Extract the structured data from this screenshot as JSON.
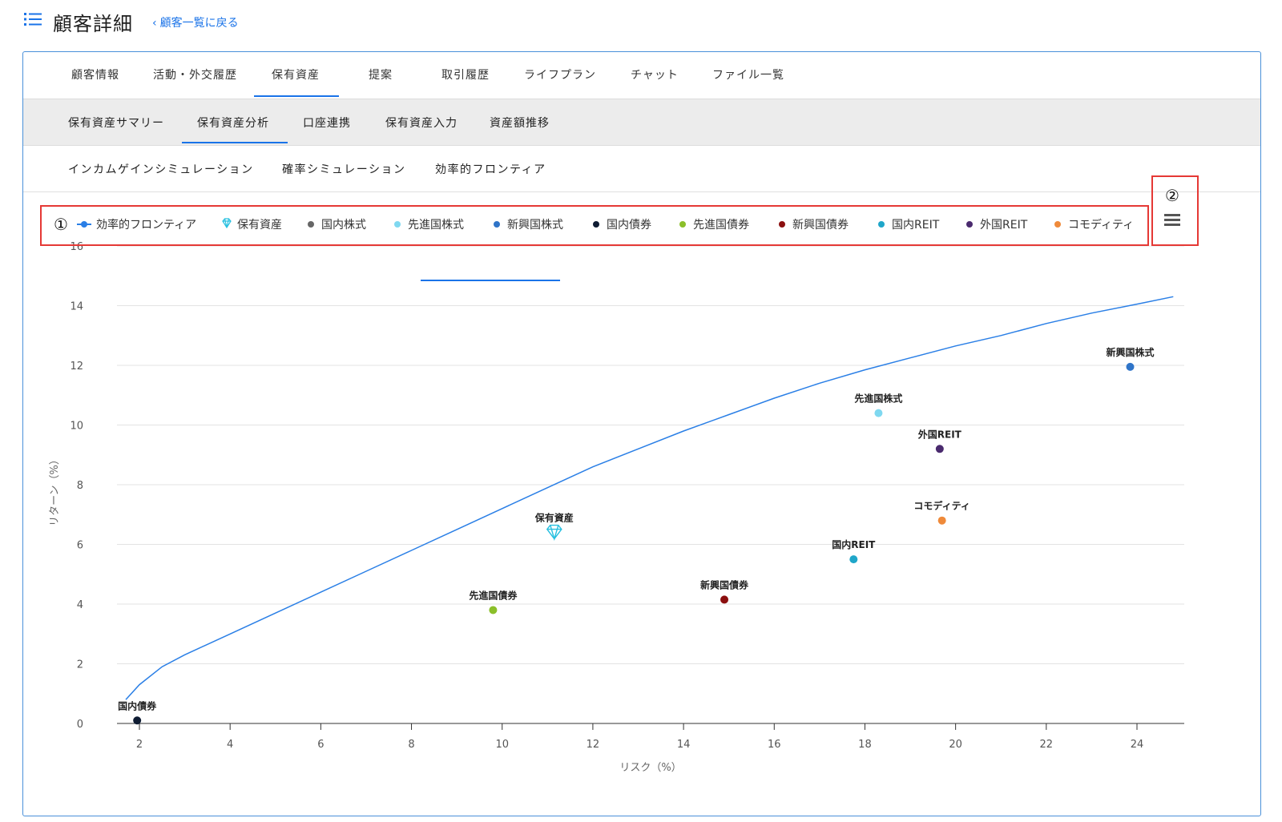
{
  "header": {
    "title": "顧客詳細",
    "back_label": "顧客一覧に戻る"
  },
  "tabs": [
    {
      "label": "顧客情報",
      "active": false
    },
    {
      "label": "活動・外交履歴",
      "active": false
    },
    {
      "label": "保有資産",
      "active": true
    },
    {
      "label": "提案",
      "active": false
    },
    {
      "label": "取引履歴",
      "active": false
    },
    {
      "label": "ライフプラン",
      "active": false
    },
    {
      "label": "チャット",
      "active": false
    },
    {
      "label": "ファイル一覧",
      "active": false
    }
  ],
  "subtabs": [
    {
      "label": "保有資産サマリー",
      "active": false
    },
    {
      "label": "保有資産分析",
      "active": true
    },
    {
      "label": "口座連携",
      "active": false
    },
    {
      "label": "保有資産入力",
      "active": false
    },
    {
      "label": "資産額推移",
      "active": false
    }
  ],
  "subsubtabs": [
    {
      "label": "インカムゲインシミュレーション",
      "active": false
    },
    {
      "label": "確率シミュレーション",
      "active": false
    },
    {
      "label": "効率的フロンティア",
      "active": true
    }
  ],
  "annotations": {
    "one": "①",
    "two": "②"
  },
  "colors": {
    "accent": "#1a73e8",
    "annotation": "#e53935",
    "frontier_line": "#2a7fe6"
  },
  "chart_data": {
    "type": "scatter",
    "xlabel": "リスク（%）",
    "ylabel": "リターン（%）",
    "xlim": [
      1.5,
      25
    ],
    "ylim": [
      0,
      16
    ],
    "x_ticks": [
      2,
      4,
      6,
      8,
      10,
      12,
      14,
      16,
      18,
      20,
      22,
      24
    ],
    "y_ticks": [
      0,
      2,
      4,
      6,
      8,
      10,
      12,
      14,
      16
    ],
    "grid": "horizontal",
    "legend": [
      {
        "name": "効率的フロンティア",
        "color": "#2a7fe6",
        "marker": "line-dot"
      },
      {
        "name": "保有資産",
        "color": "#28c0e0",
        "marker": "diamond"
      },
      {
        "name": "国内株式",
        "color": "#666666",
        "marker": "dot"
      },
      {
        "name": "先進国株式",
        "color": "#7fd8f0",
        "marker": "dot"
      },
      {
        "name": "新興国株式",
        "color": "#2f74c8",
        "marker": "dot"
      },
      {
        "name": "国内債券",
        "color": "#0f1c33",
        "marker": "dot"
      },
      {
        "name": "先進国債券",
        "color": "#8bbf2a",
        "marker": "dot"
      },
      {
        "name": "新興国債券",
        "color": "#8b0f0f",
        "marker": "dot"
      },
      {
        "name": "国内REIT",
        "color": "#1fa6c9",
        "marker": "dot"
      },
      {
        "name": "外国REIT",
        "color": "#4a2a6e",
        "marker": "dot"
      },
      {
        "name": "コモディティ",
        "color": "#ef8a3a",
        "marker": "dot"
      }
    ],
    "legend_placement": "top",
    "series": [
      {
        "name": "効率的フロンティア",
        "type": "line",
        "color": "#2a7fe6",
        "x": [
          1.7,
          2.0,
          2.5,
          3.0,
          4.0,
          5.0,
          6.0,
          7.0,
          8.0,
          9.0,
          10.0,
          11.0,
          12.0,
          13.0,
          14.0,
          15.0,
          16.0,
          17.0,
          18.0,
          19.0,
          20.0,
          21.0,
          22.0,
          23.0,
          24.0,
          24.8
        ],
        "y": [
          0.8,
          1.3,
          1.9,
          2.3,
          3.0,
          3.7,
          4.4,
          5.1,
          5.8,
          6.5,
          7.2,
          7.9,
          8.6,
          9.2,
          9.8,
          10.35,
          10.9,
          11.4,
          11.85,
          12.25,
          12.65,
          13.0,
          13.4,
          13.75,
          14.05,
          14.3
        ]
      }
    ],
    "points": [
      {
        "name": "保有資産",
        "x": 11.15,
        "y": 6.4,
        "color": "#28c0e0",
        "marker": "diamond"
      },
      {
        "name": "国内債券",
        "x": 1.95,
        "y": 0.1,
        "color": "#0f1c33",
        "marker": "dot"
      },
      {
        "name": "先進国債券",
        "x": 9.8,
        "y": 3.8,
        "color": "#8bbf2a",
        "marker": "dot"
      },
      {
        "name": "新興国債券",
        "x": 14.9,
        "y": 4.15,
        "color": "#8b0f0f",
        "marker": "dot"
      },
      {
        "name": "国内REIT",
        "x": 17.75,
        "y": 5.5,
        "color": "#1fa6c9",
        "marker": "dot"
      },
      {
        "name": "コモディティ",
        "x": 19.7,
        "y": 6.8,
        "color": "#ef8a3a",
        "marker": "dot"
      },
      {
        "name": "外国REIT",
        "x": 19.65,
        "y": 9.2,
        "color": "#4a2a6e",
        "marker": "dot"
      },
      {
        "name": "先進国株式",
        "x": 18.3,
        "y": 10.4,
        "color": "#7fd8f0",
        "marker": "dot"
      },
      {
        "name": "新興国株式",
        "x": 23.85,
        "y": 11.95,
        "color": "#2f74c8",
        "marker": "dot"
      }
    ]
  }
}
